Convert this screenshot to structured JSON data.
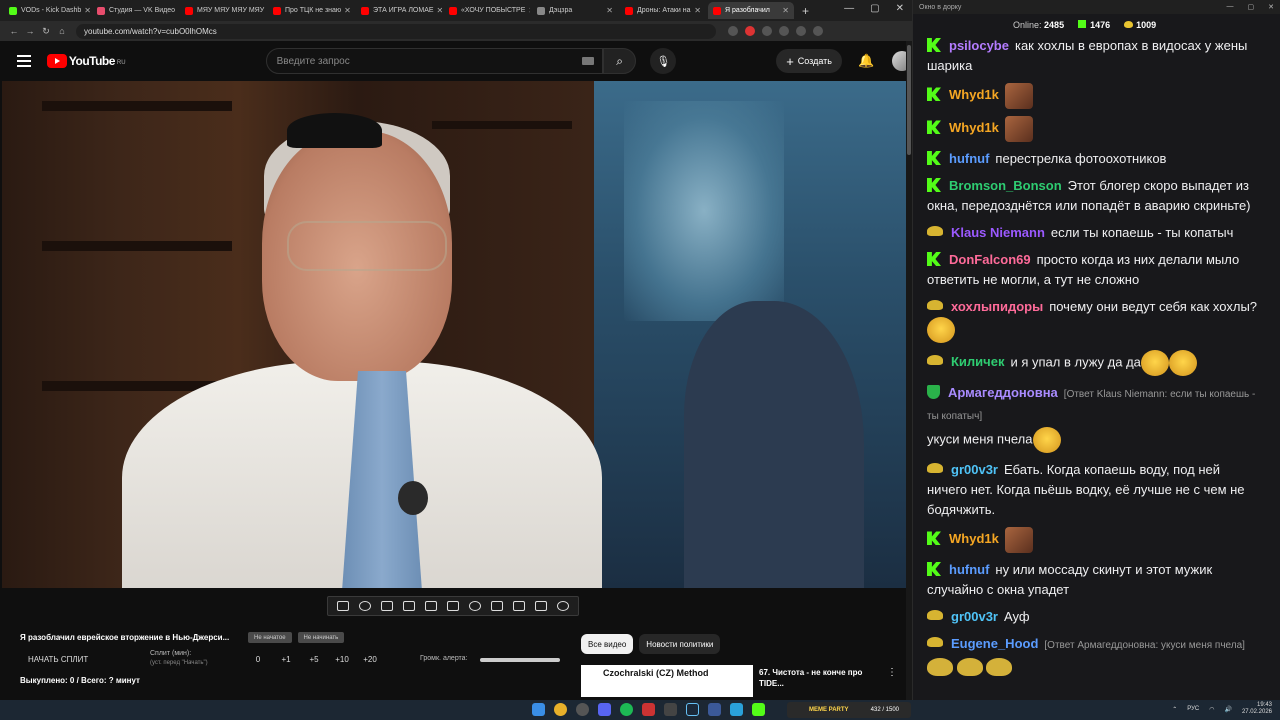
{
  "browser": {
    "tabs": [
      {
        "label": "VODs - Kick Dashb",
        "color": "#53fc18",
        "active": false
      },
      {
        "label": "Студия — VK Видео",
        "color": "#e84d6d",
        "active": false
      },
      {
        "label": "МЯУ МЯУ МЯУ МЯУ",
        "color": "#ff0000",
        "active": false
      },
      {
        "label": "Про ТЦК не знаю",
        "color": "#ff0000",
        "active": false
      },
      {
        "label": "ЭТА ИГРА ЛОМАЕ",
        "color": "#ff0000",
        "active": false
      },
      {
        "label": "«ХОЧУ ПОБЫСТРЕ",
        "color": "#ff0000",
        "active": false
      },
      {
        "label": "Дэцзра",
        "color": "#888888",
        "active": false
      },
      {
        "label": "Дроны: Атаки на",
        "color": "#ff0000",
        "active": false
      },
      {
        "label": "Я разоблачил",
        "color": "#ff0000",
        "active": true
      }
    ],
    "url": "youtube.com/watch?v=cubO0lhOMcs"
  },
  "youtube": {
    "logo_text": "YouTube",
    "logo_region": "RU",
    "search_placeholder": "Введите запрос",
    "create_label": "Создать",
    "video_title": "Я разоблачил еврейское вторжение в Нью-Джерси...",
    "pill1": "Не начатое",
    "pill2": "Не начинать",
    "split_start": "НАЧАТЬ СПЛИТ",
    "split_label": "Сплит (мин):",
    "split_sub": "(уст. перед \"Начать\")",
    "split_values": [
      "0",
      "+1",
      "+5",
      "+10",
      "+20"
    ],
    "alert_label": "Громк. алерта:",
    "bought": "Выкуплено: 0 / Всего: ? минут",
    "chips": [
      "Все видео",
      "Новости политики"
    ],
    "rec_thumb_text": "Czochralski (CZ) Method",
    "rec_title": "67. Чистота - не конче про TIDE..."
  },
  "chat": {
    "window_title": "Окно в дорку",
    "online_label": "Online:",
    "online_count": "2485",
    "kick_count": "1476",
    "pepe_count": "1009",
    "messages": [
      {
        "badge": "kick",
        "user": "psilocybe",
        "color": "#b47cff",
        "text": "как хохлы в европах в видосах у жены шарика",
        "emote": ""
      },
      {
        "badge": "kick",
        "user": "Whyd1k",
        "color": "#f5a623",
        "text": "",
        "emote": "face"
      },
      {
        "badge": "kick",
        "user": "Whyd1k",
        "color": "#f5a623",
        "text": "",
        "emote": "face"
      },
      {
        "badge": "kick",
        "user": "hufnuf",
        "color": "#5b9cff",
        "text": "перестрелка фотоохотников",
        "emote": ""
      },
      {
        "badge": "kick",
        "user": "Bromson_Bonson",
        "color": "#2ecc71",
        "text": "Этот блогер скоро выпадет из окна, передозднётся или попадёт в аварию скриньте)",
        "emote": ""
      },
      {
        "badge": "pepe",
        "user": "Klaus Niemann",
        "color": "#9b59ff",
        "text": "если ты копаешь - ты копатыч",
        "emote": ""
      },
      {
        "badge": "kick",
        "user": "DonFalcon69",
        "color": "#ff6b9a",
        "text": "просто когда из них делали мыло ответить не могли, а тут не сложно",
        "emote": ""
      },
      {
        "badge": "pepe",
        "user": "хохлыпидоры",
        "color": "#ff6b9a",
        "text": "почему они ведут себя как хохлы?",
        "emote": "laugh"
      },
      {
        "badge": "pepe",
        "user": "Киличек",
        "color": "#2ecc71",
        "text": "и я упал в лужу да да",
        "emote": "laugh2"
      },
      {
        "badge": "shield",
        "user": "Армагеддоновна",
        "color": "#a98bff",
        "reply": "[Ответ Klaus Niemann: если ты копаешь - ты копатыч]",
        "text": "укуси меня пчела",
        "emote": "laugh"
      },
      {
        "badge": "pepe",
        "user": "gr00v3r",
        "color": "#4fc3f7",
        "text": "Ебать. Когда копаешь воду, под ней ничего нет. Когда пьёшь водку, её лучше не с чем не бодячжить.",
        "emote": ""
      },
      {
        "badge": "kick",
        "user": "Whyd1k",
        "color": "#f5a623",
        "text": "",
        "emote": "face"
      },
      {
        "badge": "kick",
        "user": "hufnuf",
        "color": "#5b9cff",
        "text": "ну или моссаду скинут и этот мужик случайно с окна упадет",
        "emote": ""
      },
      {
        "badge": "pepe",
        "user": "gr00v3r",
        "color": "#4fc3f7",
        "text": "Ауф",
        "emote": ""
      },
      {
        "badge": "pepe",
        "user": "Eugene_Hood",
        "color": "#5b9cff",
        "reply": "[Ответ Армагеддоновна: укуси меня пчела]",
        "text": "",
        "emote": "pepe3"
      }
    ]
  },
  "taskbar": {
    "meme_label": "MEME PARTY",
    "meme_count": "432 / 1500",
    "lang": "РУС",
    "time": "19:43",
    "date": "27.02.2026"
  }
}
